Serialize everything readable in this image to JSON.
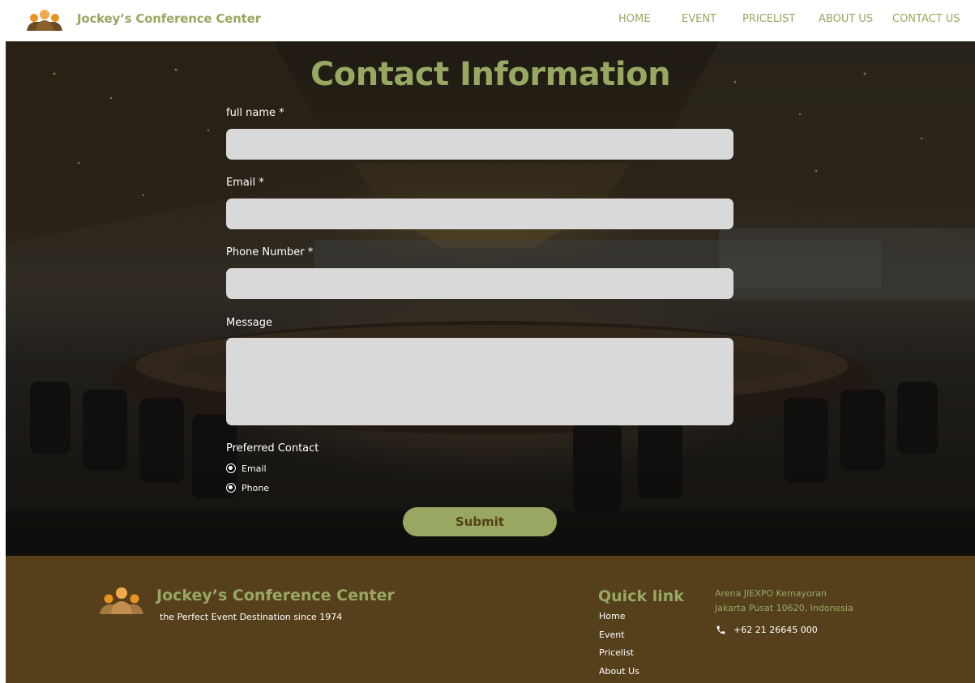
{
  "header": {
    "brand": "Jockey’s Conference Center",
    "nav": [
      {
        "label": "HOME"
      },
      {
        "label": "EVENT"
      },
      {
        "label": "PRICELIST"
      },
      {
        "label": "ABOUT US"
      },
      {
        "label": "CONTACT US"
      }
    ]
  },
  "form": {
    "title": "Contact Information",
    "fields": {
      "full_name": {
        "label": "full name *",
        "value": ""
      },
      "email": {
        "label": "Email *",
        "value": ""
      },
      "phone": {
        "label": "Phone Number *",
        "value": ""
      },
      "message": {
        "label": "Message",
        "value": ""
      }
    },
    "preferred": {
      "label": "Preferred Contact",
      "options": [
        {
          "label": "Email"
        },
        {
          "label": "Phone"
        }
      ]
    },
    "submit": "Submit"
  },
  "footer": {
    "brand": "Jockey’s Conference Center",
    "tagline": "the Perfect Event Destination since 1974",
    "quick_title": "Quick link",
    "links": [
      {
        "label": "Home"
      },
      {
        "label": "Event"
      },
      {
        "label": "Pricelist"
      },
      {
        "label": "About Us"
      }
    ],
    "address_line1": "Arena JIEXPO Kemayoran",
    "address_line2": "Jakarta Pusat 10620, Indonesia",
    "phone": "+62 21 26645 000"
  },
  "colors": {
    "accent": "#98a862",
    "footer_bg": "#56401c",
    "input_bg": "#d9d9d9"
  }
}
